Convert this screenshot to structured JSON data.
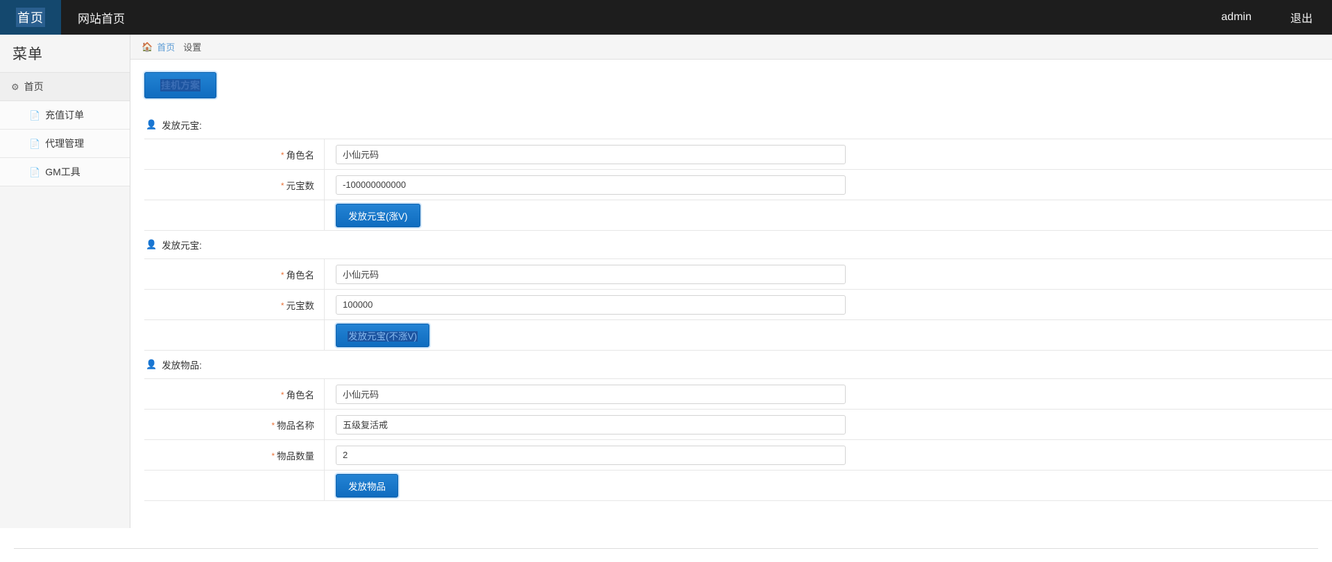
{
  "navbar": {
    "brand": "首页",
    "site_home": "网站首页",
    "user": "admin",
    "logout": "退出"
  },
  "sidebar": {
    "title": "菜单",
    "group": {
      "label": "首页",
      "icon": "gear-icon"
    },
    "items": [
      {
        "label": "充值订单",
        "icon": "file-icon"
      },
      {
        "label": "代理管理",
        "icon": "file-icon"
      },
      {
        "label": "GM工具",
        "icon": "file-icon"
      }
    ]
  },
  "breadcrumb": {
    "home_icon": "home-icon",
    "home": "首页",
    "current": "设置"
  },
  "toolbar": {
    "primary_button": "挂机方案"
  },
  "sections": [
    {
      "title": "发放元宝:",
      "icon": "user-icon",
      "rows": [
        {
          "label": "角色名",
          "required": "*",
          "value": "小仙元码"
        },
        {
          "label": "元宝数",
          "required": "*",
          "value": "-100000000000"
        }
      ],
      "submit": "发放元宝(涨V)"
    },
    {
      "title": "发放元宝:",
      "icon": "user-icon",
      "rows": [
        {
          "label": "角色名",
          "required": "*",
          "value": "小仙元码"
        },
        {
          "label": "元宝数",
          "required": "*",
          "value": "100000"
        }
      ],
      "submit": "发放元宝(不涨V)"
    },
    {
      "title": "发放物品:",
      "icon": "user-icon",
      "rows": [
        {
          "label": "角色名",
          "required": "*",
          "value": "小仙元码"
        },
        {
          "label": "物品名称",
          "required": "*",
          "value": "五级复活戒"
        },
        {
          "label": "物品数量",
          "required": "*",
          "value": "2"
        }
      ],
      "submit": "发放物品"
    }
  ],
  "colors": {
    "navbar_bg": "#1d1d1d",
    "brand_bg": "#14486e",
    "primary": "#0f6cbf",
    "link": "#5b9bd5",
    "required": "#e8743b",
    "sidebar_bg": "#f5f5f5"
  }
}
